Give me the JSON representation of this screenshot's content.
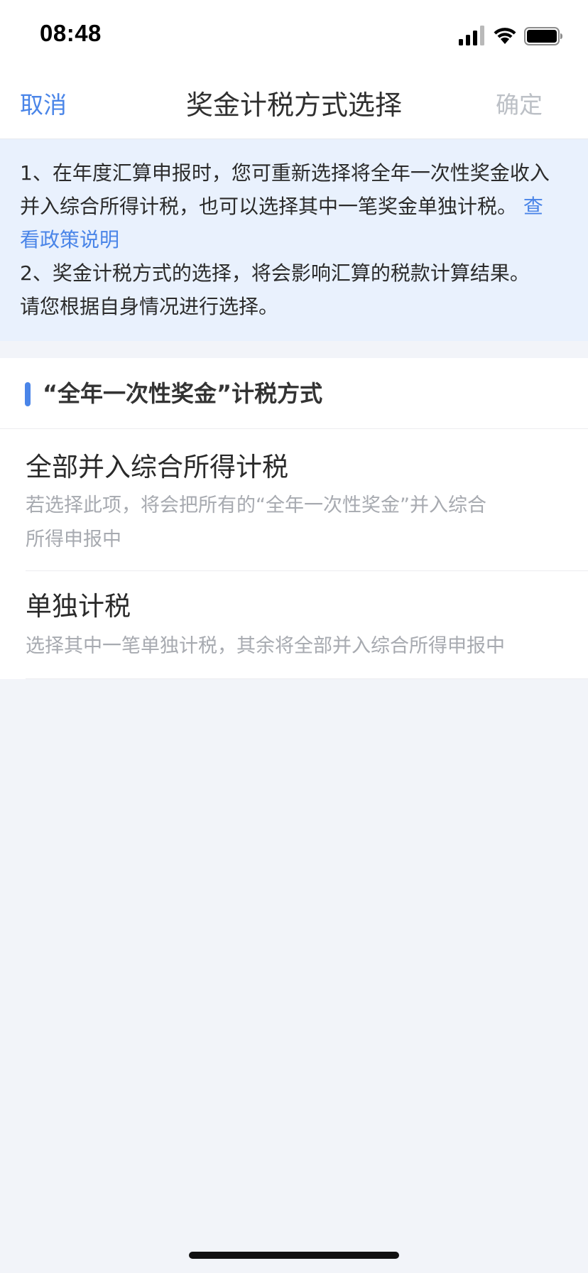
{
  "status_bar": {
    "time": "08:48",
    "signal_icon": "cellular-signal-icon",
    "wifi_icon": "wifi-icon",
    "battery_icon": "battery-icon"
  },
  "nav": {
    "cancel_label": "取消",
    "title": "奖金计税方式选择",
    "confirm_label": "确定"
  },
  "notice": {
    "line1": "1、在年度汇算申报时，您可重新选择将全年一次性奖金收入",
    "line2_text": "并入综合所得计税，也可以选择其中一笔奖金单独计税。",
    "link_part1": "查",
    "link_part2": "看政策说明",
    "line4": "2、奖金计税方式的选择，将会影响汇算的税款计算结果。",
    "line5": "请您根据自身情况进行选择。"
  },
  "section": {
    "title": "“全年一次性奖金”计税方式",
    "options": [
      {
        "title": "全部并入综合所得计税",
        "desc_line1": "若选择此项，将会把所有的“全年一次性奖金”并入综合",
        "desc_line2": "所得申报中"
      },
      {
        "title": "单独计税",
        "desc_line1": "选择其中一笔单独计税，其余将全部并入综合所得申报中"
      }
    ]
  },
  "colors": {
    "accent": "#4a85e8",
    "notice_bg": "#e9f1fd",
    "page_bg": "#f2f4f9",
    "disabled_text": "#bcc0c6",
    "secondary_text": "#a7aab0"
  }
}
